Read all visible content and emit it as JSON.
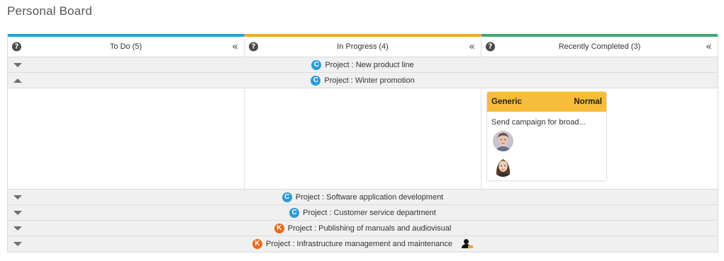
{
  "page": {
    "title": "Personal Board"
  },
  "columns": [
    {
      "name": "To Do",
      "count": "(5)",
      "color": "#2e9ad8",
      "help": "?",
      "collapse": "«"
    },
    {
      "name": "In Progress",
      "count": "(4)",
      "color": "#f0a833",
      "help": "?",
      "collapse": "«"
    },
    {
      "name": "Recently Completed",
      "count": "(3)",
      "color": "#3ea872",
      "help": "?",
      "collapse": "«"
    }
  ],
  "lanes": [
    {
      "badge": "C",
      "label": "Project : New product line",
      "state": "collapsed"
    },
    {
      "badge": "C",
      "label": "Project : Winter promotion",
      "state": "expanded"
    },
    {
      "badge": "C",
      "label": "Project : Software application development",
      "state": "collapsed"
    },
    {
      "badge": "C",
      "label": "Project : Customer service department",
      "state": "collapsed"
    },
    {
      "badge": "K",
      "label": "Project : Publishing of manuals and audiovisual",
      "state": "collapsed"
    },
    {
      "badge": "K",
      "label": "Project : Infrastructure management and maintenance",
      "state": "collapsed",
      "owner_icon": "person-icon"
    }
  ],
  "card": {
    "type": "Generic",
    "priority": "Normal",
    "title": "Send campaign for broad...",
    "header_color": "#f8bc3b"
  },
  "icons": {
    "help": "question-circle-icon",
    "collapse": "double-chevron-left-icon",
    "lane_down": "triangle-down-icon",
    "lane_up": "triangle-up-icon"
  }
}
